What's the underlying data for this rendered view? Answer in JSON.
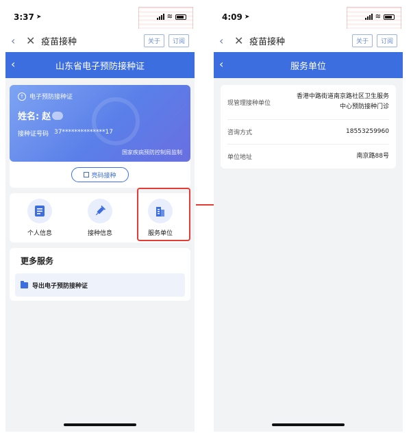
{
  "left": {
    "status": {
      "time": "3:37"
    },
    "app": {
      "title": "疫苗接种",
      "about": "关于",
      "subscribe": "订阅"
    },
    "nav": {
      "title": "山东省电子预防接种证"
    },
    "card": {
      "header": "电子预防接种证",
      "name_label": "姓名:",
      "name_value": "赵",
      "id_label": "接种证号码",
      "id_value": "37**************17",
      "footer": "国家疾病预防控制局监制"
    },
    "qr_button": "亮码接种",
    "functions": [
      {
        "label": "个人信息",
        "icon": "document-icon"
      },
      {
        "label": "接种信息",
        "icon": "syringe-icon"
      },
      {
        "label": "服务单位",
        "icon": "building-icon"
      }
    ],
    "more": {
      "title": "更多服务",
      "item": "导出电子预防接种证"
    }
  },
  "right": {
    "status": {
      "time": "4:09"
    },
    "app": {
      "title": "疫苗接种",
      "about": "关于",
      "subscribe": "订阅"
    },
    "nav": {
      "title": "服务单位"
    },
    "rows": [
      {
        "key": "现管理接种单位",
        "value": "香港中路街道南京路社区卫生服务中心预防接种门诊"
      },
      {
        "key": "咨询方式",
        "value": "18553259960"
      },
      {
        "key": "单位地址",
        "value": "南京路88号"
      }
    ]
  },
  "colors": {
    "primary": "#3c6ee0",
    "highlight": "#e43b34"
  }
}
